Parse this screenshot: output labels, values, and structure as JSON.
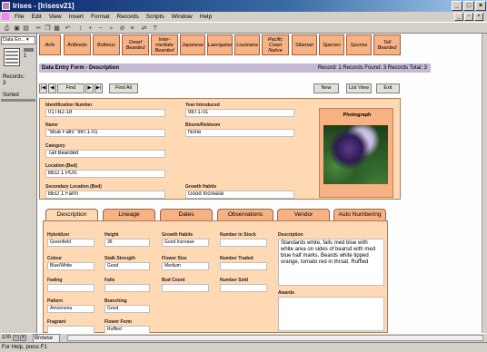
{
  "window": {
    "title": "Irises - [Irisesv21]"
  },
  "menu": [
    "File",
    "Edit",
    "View",
    "Insert",
    "Format",
    "Records",
    "Scripts",
    "Window",
    "Help"
  ],
  "left_pane": {
    "layout_select": "Data En...",
    "records_label": "Records:",
    "records_value": "3",
    "sorted_label": "Sorted",
    "record_number": "1"
  },
  "header_buttons": [
    "Arils",
    "Arilbreds",
    "Bulbous",
    "Dwarf Bearded",
    "Inter-mediate Bearded",
    "Japanese",
    "Laevigatas",
    "Louisiana",
    "Pacific Coast Native",
    "Siberian",
    "Species",
    "Spurias",
    "Tall Bearded"
  ],
  "infobar": {
    "title": "Data Entry Form - Description",
    "record_info": "Record: 1   Records Found: 3   Records Total: 3"
  },
  "nav": {
    "find": "Find",
    "find_all": "Find All",
    "new": "New",
    "list_view": "List View",
    "exit": "Exit"
  },
  "form": {
    "id_label": "Identification Number",
    "id_value": "01TB2-18",
    "year_label": "Year Introduced",
    "year_value": "98T1-01",
    "name_label": "Name",
    "name_value": "\"Blue Falls\" 98T1-01",
    "bloom_label": "Bloom/Rebloom",
    "bloom_value": "None",
    "category_label": "Category",
    "category_value": "Tall Bearded",
    "location_label": "Location (Bed)",
    "location_value": "BED 1 POS",
    "secondary_label": "Secondary Location (Bed)",
    "secondary_value": "BED 1 Farm",
    "growth_label": "Growth Habits",
    "growth_value": "Good Increase",
    "photo_label": "Photograph"
  },
  "tabs": [
    "Description",
    "Lineage",
    "Dates",
    "Observations",
    "Vendor",
    "Auto Numbering"
  ],
  "description_tab": {
    "hybridizer_label": "Hybridizer",
    "hybridizer_value": "Greenfield",
    "height_label": "Height",
    "height_value": "36",
    "habit_label": "Growth Habits",
    "habit_value": "Good Increase",
    "stock_label": "Number in Stock",
    "stock_value": "",
    "colour_label": "Colour",
    "colour_value": "Blue/White",
    "stalk_label": "Stalk Strength",
    "stalk_value": "Good",
    "flower_size_label": "Flower Size",
    "flower_size_value": "Medium",
    "traded_label": "Number Traded",
    "traded_value": "",
    "fading_label": "Fading",
    "fading_value": "",
    "falls_label": "Falls",
    "falls_value": "",
    "bud_label": "Bud Count",
    "bud_value": "",
    "sold_label": "Number Sold",
    "sold_value": "",
    "pattern_label": "Pattern",
    "pattern_value": "Amoenena",
    "branching_label": "Branching",
    "branching_value": "Good",
    "fragrant_label": "Fragrant",
    "fragrant_value": "",
    "form_label": "Flower Form",
    "form_value": "Ruffled",
    "description_label": "Description",
    "description_text": "Standards white, falls med blue with white area on sides of bearsd with med blue half marks. Beards white tipped orange, tomato red in throat. Ruffled",
    "awards_label": "Awards"
  },
  "status": {
    "zoom": "100",
    "mode": "Browse",
    "help": "For Help, press F1"
  }
}
